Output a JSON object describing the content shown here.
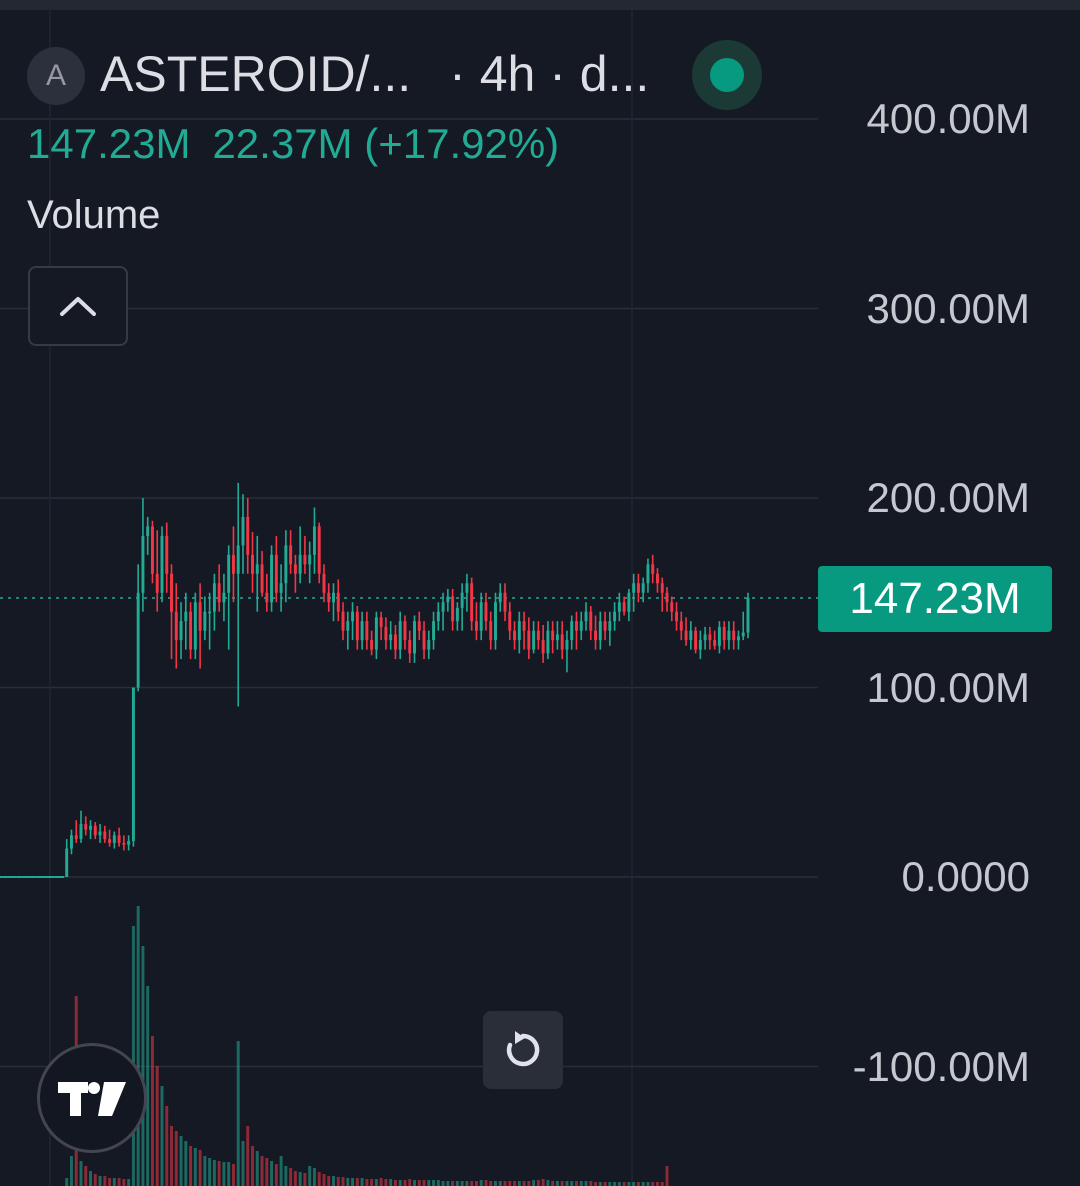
{
  "header": {
    "avatar_letter": "A",
    "symbol": "ASTEROID/...",
    "interval": "· 4h · d...",
    "ohlc_value": "147.23M",
    "change": "22.37M (+17.92%)",
    "indicator_label": "Volume"
  },
  "colors": {
    "background": "#151924",
    "up": "#22ab94",
    "down": "#f23645",
    "grid": "#2a2e39",
    "price_tag": "#089981"
  },
  "icons": {
    "collapse": "chevron-up-icon",
    "logo": "tradingview-logo-icon",
    "reset": "reset-icon",
    "status": "status-dot-icon"
  },
  "chart_data": {
    "type": "candlestick",
    "title": "",
    "ylim": [
      -110,
      420
    ],
    "y_ticks": [
      "400.00M",
      "300.00M",
      "200.00M",
      "100.00M",
      "0.0000",
      "-100.00M"
    ],
    "y_tick_values": [
      400,
      300,
      200,
      100,
      0,
      -100
    ],
    "y_unit": "M",
    "last_price": 147.23,
    "last_price_label": "147.23M",
    "grid": true,
    "candles": [
      [
        0,
        0,
        0,
        0
      ],
      [
        0,
        0,
        0,
        0
      ],
      [
        0,
        0,
        0,
        0
      ],
      [
        0,
        0,
        0,
        0
      ],
      [
        0,
        0,
        0,
        0
      ],
      [
        0,
        0,
        0,
        0
      ],
      [
        0,
        0,
        0,
        0
      ],
      [
        0,
        0,
        0,
        0
      ],
      [
        0,
        0,
        0,
        0
      ],
      [
        0,
        0,
        0,
        0
      ],
      [
        0,
        0,
        0,
        0
      ],
      [
        0,
        0,
        0,
        0
      ],
      [
        0,
        0,
        0,
        0
      ],
      [
        0,
        0,
        0,
        0
      ],
      [
        0,
        20,
        0,
        15
      ],
      [
        15,
        25,
        12,
        22
      ],
      [
        22,
        30,
        18,
        20
      ],
      [
        20,
        35,
        18,
        28
      ],
      [
        28,
        32,
        22,
        25
      ],
      [
        25,
        30,
        20,
        27
      ],
      [
        27,
        29,
        20,
        22
      ],
      [
        22,
        28,
        18,
        24
      ],
      [
        24,
        27,
        18,
        20
      ],
      [
        20,
        25,
        16,
        18
      ],
      [
        18,
        24,
        15,
        22
      ],
      [
        22,
        26,
        16,
        18
      ],
      [
        18,
        22,
        14,
        17
      ],
      [
        17,
        22,
        14,
        19
      ],
      [
        19,
        100,
        16,
        100
      ],
      [
        100,
        165,
        98,
        150
      ],
      [
        150,
        200,
        140,
        180
      ],
      [
        180,
        190,
        170,
        185
      ],
      [
        185,
        188,
        155,
        160
      ],
      [
        160,
        183,
        140,
        150
      ],
      [
        150,
        185,
        145,
        180
      ],
      [
        180,
        187,
        150,
        160
      ],
      [
        160,
        165,
        115,
        140
      ],
      [
        140,
        155,
        110,
        125
      ],
      [
        125,
        145,
        115,
        135
      ],
      [
        135,
        150,
        120,
        140
      ],
      [
        140,
        145,
        115,
        120
      ],
      [
        120,
        150,
        115,
        145
      ],
      [
        145,
        155,
        110,
        130
      ],
      [
        130,
        148,
        125,
        140
      ],
      [
        140,
        150,
        120,
        140
      ],
      [
        140,
        160,
        130,
        155
      ],
      [
        155,
        165,
        140,
        145
      ],
      [
        145,
        160,
        135,
        150
      ],
      [
        150,
        175,
        120,
        170
      ],
      [
        170,
        185,
        145,
        160
      ],
      [
        160,
        208,
        90,
        175
      ],
      [
        175,
        202,
        160,
        190
      ],
      [
        190,
        200,
        160,
        170
      ],
      [
        170,
        182,
        150,
        160
      ],
      [
        160,
        180,
        140,
        165
      ],
      [
        165,
        172,
        148,
        150
      ],
      [
        150,
        160,
        140,
        145
      ],
      [
        145,
        175,
        140,
        170
      ],
      [
        170,
        180,
        145,
        150
      ],
      [
        150,
        165,
        140,
        155
      ],
      [
        155,
        183,
        145,
        175
      ],
      [
        175,
        183,
        160,
        165
      ],
      [
        165,
        170,
        150,
        160
      ],
      [
        160,
        185,
        155,
        170
      ],
      [
        170,
        180,
        160,
        165
      ],
      [
        165,
        177,
        155,
        170
      ],
      [
        170,
        195,
        160,
        185
      ],
      [
        185,
        187,
        155,
        160
      ],
      [
        160,
        165,
        145,
        150
      ],
      [
        150,
        155,
        140,
        145
      ],
      [
        145,
        155,
        135,
        150
      ],
      [
        150,
        157,
        135,
        140
      ],
      [
        140,
        145,
        125,
        130
      ],
      [
        130,
        140,
        120,
        135
      ],
      [
        135,
        145,
        125,
        140
      ],
      [
        140,
        143,
        120,
        125
      ],
      [
        125,
        140,
        120,
        135
      ],
      [
        135,
        140,
        120,
        125
      ],
      [
        125,
        130,
        117,
        120
      ],
      [
        120,
        140,
        115,
        137
      ],
      [
        137,
        140,
        125,
        132
      ],
      [
        132,
        137,
        120,
        125
      ],
      [
        125,
        135,
        120,
        128
      ],
      [
        128,
        133,
        115,
        120
      ],
      [
        120,
        140,
        115,
        135
      ],
      [
        135,
        138,
        120,
        125
      ],
      [
        125,
        130,
        113,
        118
      ],
      [
        118,
        138,
        113,
        135
      ],
      [
        135,
        140,
        125,
        130
      ],
      [
        130,
        135,
        115,
        120
      ],
      [
        120,
        130,
        115,
        125
      ],
      [
        125,
        140,
        120,
        135
      ],
      [
        135,
        145,
        130,
        140
      ],
      [
        140,
        150,
        130,
        145
      ],
      [
        145,
        152,
        140,
        148
      ],
      [
        148,
        152,
        130,
        135
      ],
      [
        135,
        145,
        130,
        142
      ],
      [
        142,
        155,
        130,
        150
      ],
      [
        150,
        160,
        140,
        155
      ],
      [
        155,
        158,
        130,
        135
      ],
      [
        135,
        145,
        125,
        130
      ],
      [
        130,
        150,
        125,
        145
      ],
      [
        145,
        150,
        130,
        135
      ],
      [
        135,
        140,
        120,
        125
      ],
      [
        125,
        150,
        120,
        145
      ],
      [
        145,
        155,
        140,
        150
      ],
      [
        150,
        155,
        135,
        140
      ],
      [
        140,
        145,
        125,
        130
      ],
      [
        130,
        135,
        120,
        125
      ],
      [
        125,
        140,
        118,
        135
      ],
      [
        135,
        140,
        120,
        130
      ],
      [
        130,
        137,
        115,
        120
      ],
      [
        120,
        135,
        118,
        130
      ],
      [
        130,
        135,
        120,
        125
      ],
      [
        125,
        133,
        113,
        118
      ],
      [
        118,
        135,
        115,
        130
      ],
      [
        130,
        135,
        118,
        125
      ],
      [
        125,
        135,
        120,
        128
      ],
      [
        128,
        135,
        115,
        120
      ],
      [
        120,
        130,
        108,
        125
      ],
      [
        125,
        138,
        120,
        135
      ],
      [
        135,
        140,
        120,
        130
      ],
      [
        130,
        140,
        125,
        135
      ],
      [
        135,
        145,
        130,
        140
      ],
      [
        140,
        143,
        125,
        130
      ],
      [
        130,
        138,
        120,
        125
      ],
      [
        125,
        140,
        120,
        135
      ],
      [
        135,
        140,
        125,
        130
      ],
      [
        130,
        140,
        122,
        135
      ],
      [
        135,
        145,
        130,
        140
      ],
      [
        140,
        150,
        135,
        145
      ],
      [
        145,
        148,
        138,
        140
      ],
      [
        140,
        152,
        135,
        150
      ],
      [
        150,
        160,
        140,
        155
      ],
      [
        155,
        160,
        145,
        150
      ],
      [
        150,
        158,
        145,
        155
      ],
      [
        155,
        168,
        150,
        165
      ],
      [
        165,
        170,
        155,
        160
      ],
      [
        160,
        163,
        150,
        155
      ],
      [
        155,
        158,
        140,
        150
      ],
      [
        150,
        153,
        140,
        145
      ],
      [
        145,
        148,
        135,
        140
      ],
      [
        140,
        145,
        130,
        135
      ],
      [
        135,
        140,
        125,
        130
      ],
      [
        130,
        137,
        122,
        125
      ],
      [
        125,
        135,
        120,
        130
      ],
      [
        130,
        132,
        118,
        120
      ],
      [
        120,
        130,
        115,
        125
      ],
      [
        125,
        132,
        120,
        128
      ],
      [
        128,
        132,
        120,
        125
      ],
      [
        125,
        130,
        120,
        122
      ],
      [
        122,
        135,
        118,
        132
      ],
      [
        132,
        135,
        120,
        125
      ],
      [
        125,
        135,
        120,
        130
      ],
      [
        130,
        135,
        120,
        125
      ],
      [
        125,
        130,
        120,
        127
      ],
      [
        127,
        140,
        125,
        129
      ],
      [
        129,
        150,
        126,
        147.23
      ]
    ],
    "volume_heights": [
      0,
      0,
      0,
      0,
      0,
      0,
      0,
      0,
      0,
      0,
      0,
      0,
      0,
      0,
      8,
      30,
      190,
      25,
      20,
      15,
      12,
      10,
      10,
      8,
      8,
      8,
      7,
      7,
      260,
      280,
      240,
      200,
      150,
      120,
      100,
      80,
      60,
      55,
      50,
      45,
      40,
      38,
      36,
      30,
      28,
      26,
      25,
      24,
      24,
      22,
      145,
      45,
      60,
      40,
      35,
      30,
      28,
      25,
      22,
      30,
      20,
      18,
      15,
      14,
      13,
      20,
      18,
      14,
      12,
      10,
      10,
      9,
      9,
      8,
      8,
      8,
      8,
      7,
      7,
      7,
      8,
      7,
      7,
      6,
      6,
      6,
      7,
      6,
      6,
      6,
      6,
      6,
      6,
      5,
      5,
      5,
      5,
      5,
      5,
      5,
      5,
      6,
      6,
      5,
      5,
      5,
      5,
      5,
      5,
      5,
      5,
      5,
      6,
      6,
      7,
      6,
      5,
      5,
      5,
      5,
      5,
      5,
      5,
      5,
      5,
      4,
      4,
      4,
      4,
      4,
      4,
      4,
      4,
      4,
      4,
      4,
      4,
      4,
      4,
      4,
      20
    ]
  },
  "xaxis": {
    "tick_labels": []
  }
}
